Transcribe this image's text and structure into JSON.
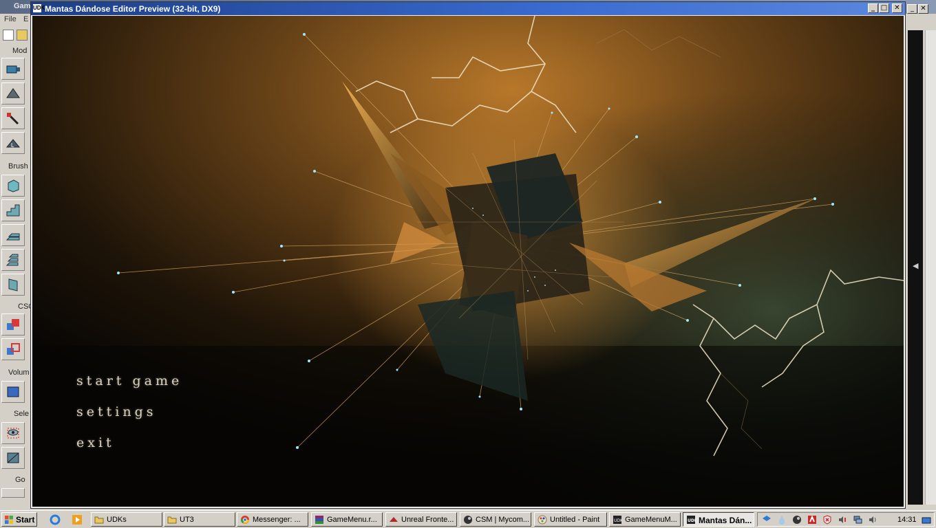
{
  "background_window": {
    "title": "Gam",
    "menu": [
      "File",
      "E"
    ],
    "sections": [
      "Mod",
      "Brush",
      "CSG",
      "Volum",
      "Sele",
      "Go"
    ]
  },
  "preview_window": {
    "title": "Mantas Dándose Editor Preview (32-bit, DX9)",
    "icon_text": "UDK",
    "buttons": {
      "minimize": "_",
      "maximize": "□",
      "close": "✕"
    }
  },
  "game_menu": {
    "items": [
      "start game",
      "settings",
      "exit"
    ]
  },
  "taskbar": {
    "start_label": "Start",
    "buttons": [
      {
        "label": "UDKs",
        "icon": "folder-icon"
      },
      {
        "label": "UT3",
        "icon": "folder-icon"
      },
      {
        "label": "Messenger: ...",
        "icon": "chrome-icon"
      },
      {
        "label": "GameMenu.r...",
        "icon": "winrar-icon"
      },
      {
        "label": "Unreal Fronte...",
        "icon": "unreal-frontend-icon"
      },
      {
        "label": "CSM | Mycom...",
        "icon": "steam-icon"
      },
      {
        "label": "Untitled - Paint",
        "icon": "paint-icon"
      },
      {
        "label": "GameMenuM...",
        "icon": "udk-icon"
      },
      {
        "label": "Mantas Dán...",
        "icon": "udk-icon",
        "active": true
      }
    ],
    "clock": "14:31"
  },
  "colors": {
    "title_active": "#2a55b0",
    "menu_text": "#d8d0c0",
    "lightning": "#f2e6c8",
    "sky_glow": "#b8782a"
  }
}
